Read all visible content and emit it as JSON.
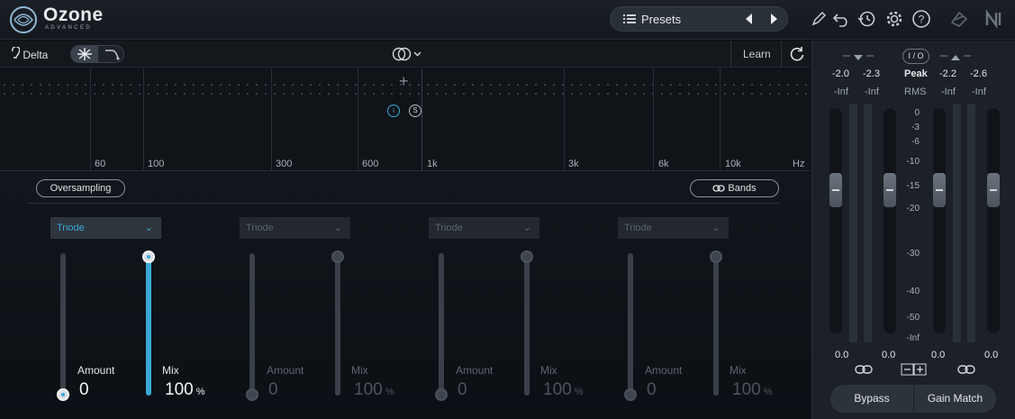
{
  "app": {
    "name": "Ozone",
    "edition": "ADVANCED"
  },
  "toolbar": {
    "presets_label": "Presets",
    "accent": "#3aa8d8"
  },
  "bar": {
    "delta_label": "Delta",
    "learn_label": "Learn"
  },
  "spectrum": {
    "freq_labels": [
      "60",
      "100",
      "300",
      "600",
      "1k",
      "3k",
      "6k",
      "10k",
      "Hz"
    ]
  },
  "module": {
    "oversampling_label": "Oversampling",
    "bands_label": "Bands",
    "bands": [
      {
        "mode": "Triode",
        "amount_label": "Amount",
        "amount_value": "0",
        "mix_label": "Mix",
        "mix_value": "100",
        "mix_unit": "%",
        "active": true,
        "amount_level": 0.0,
        "mix_level": 1.0
      },
      {
        "mode": "Triode",
        "amount_label": "Amount",
        "amount_value": "0",
        "mix_label": "Mix",
        "mix_value": "100",
        "mix_unit": "%",
        "active": false,
        "amount_level": 0.0,
        "mix_level": 1.0
      },
      {
        "mode": "Triode",
        "amount_label": "Amount",
        "amount_value": "0",
        "mix_label": "Mix",
        "mix_value": "100",
        "mix_unit": "%",
        "active": false,
        "amount_level": 0.0,
        "mix_level": 1.0
      },
      {
        "mode": "Triode",
        "amount_label": "Amount",
        "amount_value": "0",
        "mix_label": "Mix",
        "mix_value": "100",
        "mix_unit": "%",
        "active": false,
        "amount_level": 0.0,
        "mix_level": 1.0
      }
    ]
  },
  "meters": {
    "io_label": "I / O",
    "in_peak": [
      "-2.0",
      "-2.3"
    ],
    "out_peak": [
      "-2.2",
      "-2.6"
    ],
    "in_rms": [
      "-Inf",
      "-Inf"
    ],
    "out_rms": [
      "-Inf",
      "-Inf"
    ],
    "peak_label": "Peak",
    "rms_label": "RMS",
    "scale": [
      "0",
      "-3",
      "-6",
      "-10",
      "-15",
      "-20",
      "-30",
      "-40",
      "-50",
      "-Inf"
    ],
    "gain_values": [
      "0.0",
      "0.0",
      "0.0",
      "0.0"
    ],
    "bypass_label": "Bypass",
    "gain_match_label": "Gain Match"
  }
}
